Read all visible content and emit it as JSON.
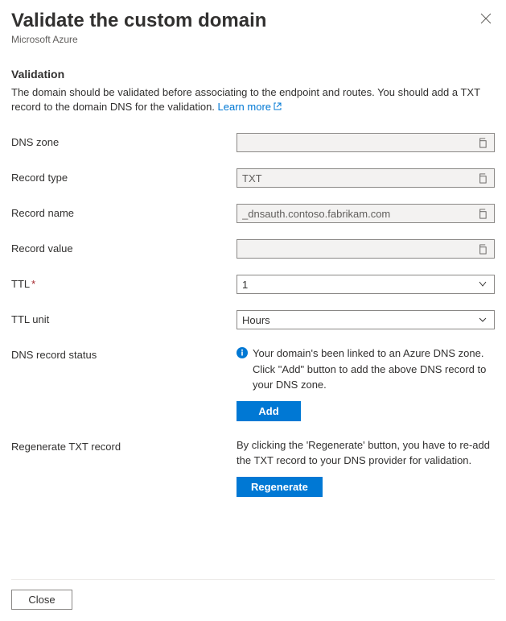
{
  "header": {
    "title": "Validate the custom domain",
    "subtitle": "Microsoft Azure"
  },
  "validation": {
    "heading": "Validation",
    "description_pre": "The domain should be validated before associating to the endpoint and routes. You should add a TXT record to the domain DNS for the validation. ",
    "learn_more": "Learn more"
  },
  "fields": {
    "dns_zone": {
      "label": "DNS zone",
      "value": ""
    },
    "record_type": {
      "label": "Record type",
      "value": "TXT"
    },
    "record_name": {
      "label": "Record name",
      "value": "_dnsauth.contoso.fabrikam.com"
    },
    "record_value": {
      "label": "Record value",
      "value": ""
    },
    "ttl": {
      "label": "TTL",
      "value": "1"
    },
    "ttl_unit": {
      "label": "TTL unit",
      "value": "Hours"
    },
    "dns_status": {
      "label": "DNS record status",
      "message": "Your domain's been linked to an Azure DNS zone. Click \"Add\" button to add the above DNS record to your DNS zone.",
      "button": "Add"
    },
    "regenerate": {
      "label": "Regenerate TXT record",
      "message": "By clicking the 'Regenerate' button, you have to re-add the TXT record to your DNS provider for validation.",
      "button": "Regenerate"
    }
  },
  "footer": {
    "close": "Close"
  }
}
